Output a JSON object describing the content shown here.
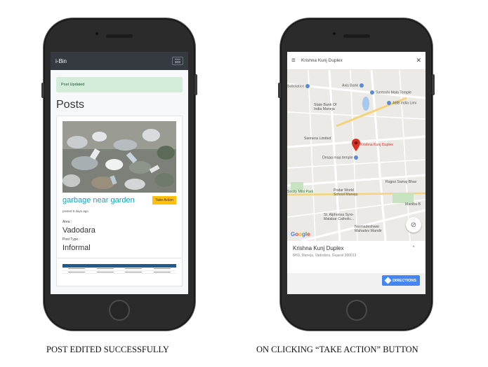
{
  "screen1": {
    "brand": "i-Bin",
    "alert": "Post Updated",
    "heading": "Posts",
    "post": {
      "title": "garbage near garden",
      "action_label": "Take Action",
      "posted": "posted 6 days ago",
      "area_label": "Area :",
      "area_value": "Vadodara",
      "type_label": "Post Type :",
      "type_value": "Informal"
    }
  },
  "screen2": {
    "search_query": "Krishna Kunj Duplex",
    "close_glyph": "✕",
    "menu_glyph": "≡",
    "map_labels": {
      "substation": "Substation",
      "axis_bank": "Axis Bank",
      "santoshi": "Santoshi Mala Temple",
      "sbi": "State Bank Of India Manejа",
      "abb": "ABB India Limi",
      "siemens": "Siemens Limited",
      "krishna": "Krishna Kunj Duplex",
      "desaa": "Desaa maa temple",
      "rajput": "Rajput Samaj Bhav",
      "socity": "Socity Mini Park",
      "podar": "Podar World School Maneja",
      "maniba": "Maniba B",
      "alphonsa": "St. Alphonsa Syro-Malabar Catholic...",
      "narmadeshwar": "Narmadeshwar Mahadev Mandir"
    },
    "google": [
      "G",
      "o",
      "o",
      "g",
      "l",
      "e"
    ],
    "place_name": "Krishna Kunj Duplex",
    "address": "8/69, Maneja, Vadodara, Gujarat 390013",
    "directions_label": "DIRECTIONS"
  },
  "captions": {
    "left": "POST EDITED SUCCESSFULLY",
    "right": "ON CLICKING “TAKE ACTION” BUTTON"
  },
  "colors": {
    "navbar": "#343a40",
    "alert_bg": "#d4edda",
    "title": "#17a2b8",
    "badge": "#ffc107",
    "directions": "#4285f4",
    "pin": "#d93025"
  }
}
